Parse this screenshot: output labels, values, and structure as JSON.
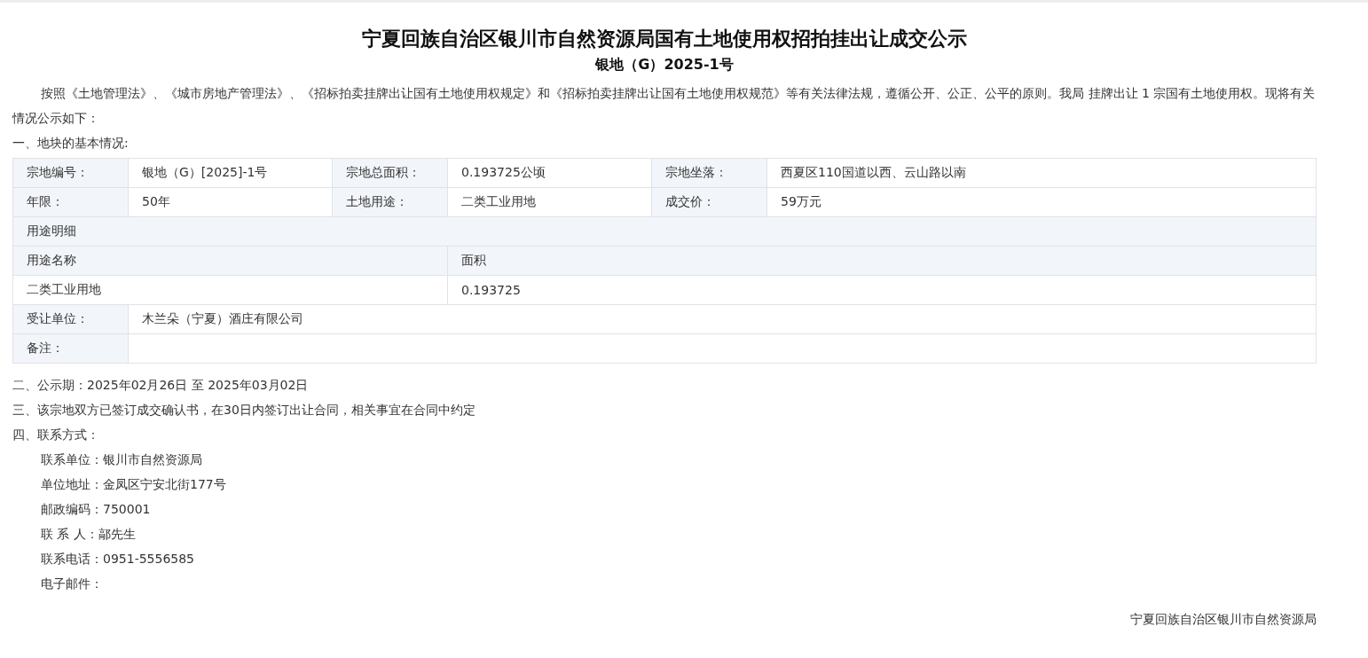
{
  "title": "宁夏回族自治区银川市自然资源局国有土地使用权招拍挂出让成交公示",
  "subtitle": "银地（G）2025-1号",
  "intro": "按照《土地管理法》、《城市房地产管理法》、《招标拍卖挂牌出让国有土地使用权规定》和《招标拍卖挂牌出让国有土地使用权规范》等有关法律法规，遵循公开、公正、公平的原则。我局 挂牌出让 1 宗国有土地使用权。现将有关情况公示如下：",
  "section_1": "一、地块的基本情况:",
  "basic_info": [
    [
      {
        "label": "宗地编号：",
        "value": "银地（G）[2025]-1号"
      },
      {
        "label": "宗地总面积：",
        "value": "0.193725公顷"
      },
      {
        "label": "宗地坐落：",
        "value": "西夏区110国道以西、云山路以南"
      }
    ],
    [
      {
        "label": "年限：",
        "value": "50年"
      },
      {
        "label": "土地用途：",
        "value": "二类工业用地"
      },
      {
        "label": "成交价：",
        "value": "59万元"
      }
    ]
  ],
  "usage_detail": {
    "title": "用途明细",
    "columns": [
      "用途名称",
      "面积"
    ],
    "rows": [
      [
        "二类工业用地",
        "0.193725"
      ]
    ]
  },
  "transferee": {
    "label": "受让单位：",
    "value": "木兰朵（宁夏）酒庄有限公司"
  },
  "remarks": {
    "label": "备注："
  },
  "section_2": "二、公示期：2025年02月26日 至 2025年03月02日",
  "section_3": "三、该宗地双方已签订成交确认书，在30日内签订出让合同，相关事宜在合同中约定",
  "section_4": "四、联系方式：",
  "contacts": [
    "联系单位：银川市自然资源局",
    "单位地址：金凤区宁安北街177号",
    "邮政编码：750001",
    "联 系 人：鄗先生",
    "联系电话：0951-5556585",
    "电子邮件："
  ],
  "signature": "宁夏回族自治区银川市自然资源局"
}
